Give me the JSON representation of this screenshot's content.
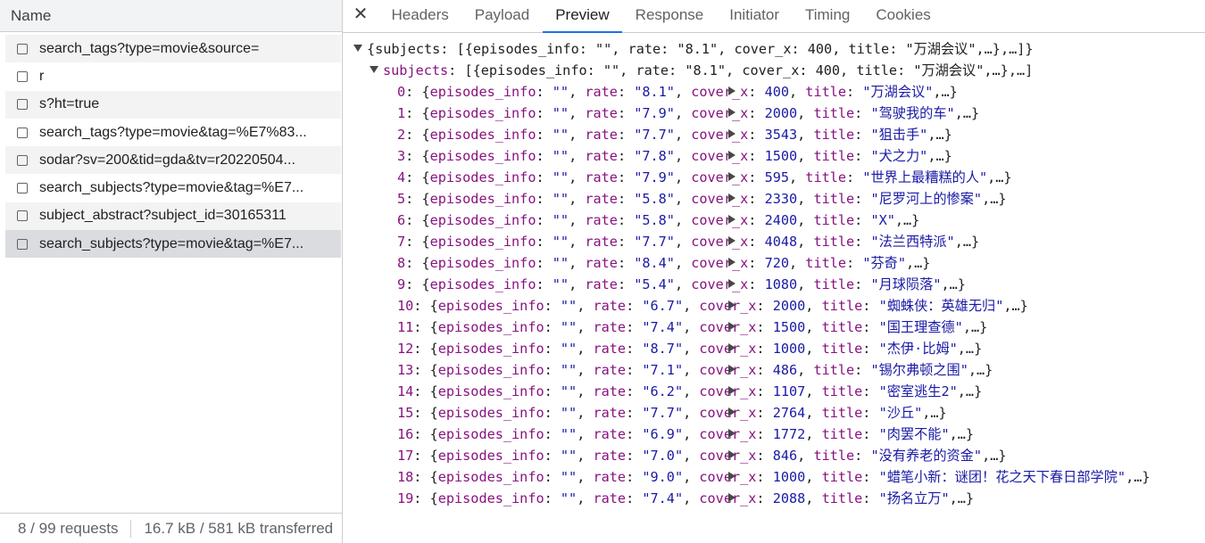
{
  "left_panel": {
    "header": "Name",
    "requests": [
      "search_tags?type=movie&source=",
      "r",
      "s?ht=true",
      "search_tags?type=movie&tag=%E7%83...",
      "sodar?sv=200&tid=gda&tv=r20220504...",
      "search_subjects?type=movie&tag=%E7...",
      "subject_abstract?subject_id=30165311",
      "search_subjects?type=movie&tag=%E7..."
    ],
    "status_requests": "8 / 99 requests",
    "status_transferred": "16.7 kB / 581 kB transferred"
  },
  "tabs": [
    "Headers",
    "Payload",
    "Preview",
    "Response",
    "Initiator",
    "Timing",
    "Cookies"
  ],
  "active_tab": "Preview",
  "preview": {
    "root_line": "{subjects: [{episodes_info: \"\", rate: \"8.1\", cover_x: 400, title: \"万湖会议\",…},…]}",
    "subjects_key": "subjects",
    "subjects_summary": "[{episodes_info: \"\", rate: \"8.1\", cover_x: 400, title: \"万湖会议\",…},…]",
    "items": [
      {
        "index": "0",
        "rate": "8.1",
        "cover_x": "400",
        "title": "万湖会议"
      },
      {
        "index": "1",
        "rate": "7.9",
        "cover_x": "2000",
        "title": "驾驶我的车"
      },
      {
        "index": "2",
        "rate": "7.7",
        "cover_x": "3543",
        "title": "狙击手"
      },
      {
        "index": "3",
        "rate": "7.8",
        "cover_x": "1500",
        "title": "犬之力"
      },
      {
        "index": "4",
        "rate": "7.9",
        "cover_x": "595",
        "title": "世界上最糟糕的人"
      },
      {
        "index": "5",
        "rate": "5.8",
        "cover_x": "2330",
        "title": "尼罗河上的惨案"
      },
      {
        "index": "6",
        "rate": "5.8",
        "cover_x": "2400",
        "title": "X"
      },
      {
        "index": "7",
        "rate": "7.7",
        "cover_x": "4048",
        "title": "法兰西特派"
      },
      {
        "index": "8",
        "rate": "8.4",
        "cover_x": "720",
        "title": "芬奇"
      },
      {
        "index": "9",
        "rate": "5.4",
        "cover_x": "1080",
        "title": "月球陨落"
      },
      {
        "index": "10",
        "rate": "6.7",
        "cover_x": "2000",
        "title": "蜘蛛侠：英雄无归"
      },
      {
        "index": "11",
        "rate": "7.4",
        "cover_x": "1500",
        "title": "国王理查德"
      },
      {
        "index": "12",
        "rate": "8.7",
        "cover_x": "1000",
        "title": "杰伊·比姆"
      },
      {
        "index": "13",
        "rate": "7.1",
        "cover_x": "486",
        "title": "锡尔弗顿之围"
      },
      {
        "index": "14",
        "rate": "6.2",
        "cover_x": "1107",
        "title": "密室逃生2"
      },
      {
        "index": "15",
        "rate": "7.7",
        "cover_x": "2764",
        "title": "沙丘"
      },
      {
        "index": "16",
        "rate": "6.9",
        "cover_x": "1772",
        "title": "肉罢不能"
      },
      {
        "index": "17",
        "rate": "7.0",
        "cover_x": "846",
        "title": "没有养老的资金"
      },
      {
        "index": "18",
        "rate": "9.0",
        "cover_x": "1000",
        "title": "蜡笔小新：谜团！花之天下春日部学院"
      },
      {
        "index": "19",
        "rate": "7.4",
        "cover_x": "2088",
        "title": "扬名立万"
      }
    ]
  }
}
